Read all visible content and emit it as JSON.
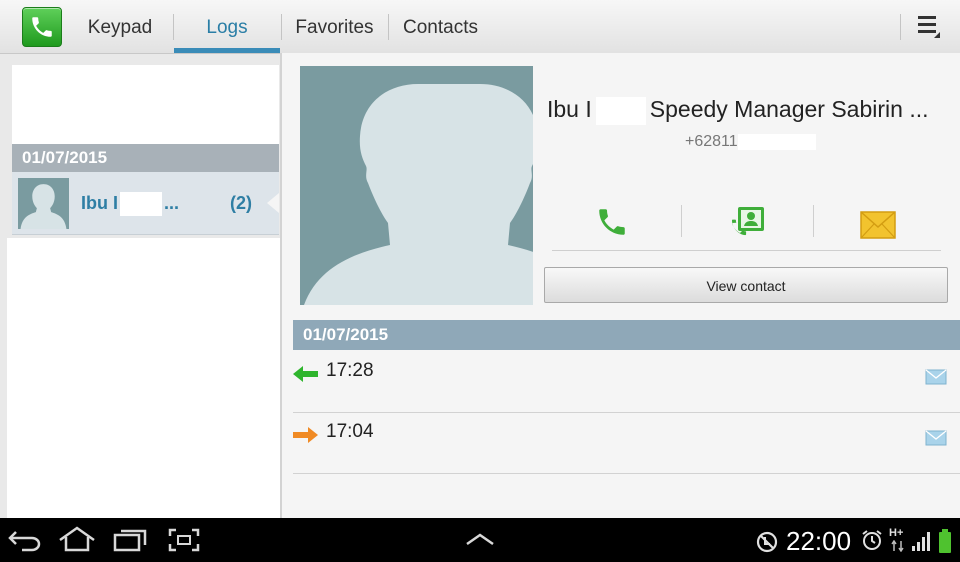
{
  "tabs": [
    {
      "label": "Keypad",
      "active": false
    },
    {
      "label": "Logs",
      "active": true
    },
    {
      "label": "Favorites",
      "active": false
    },
    {
      "label": "Contacts",
      "active": false
    }
  ],
  "left_list": {
    "date_header": "01/07/2015",
    "items": [
      {
        "name": "Ibu I",
        "name_suffix": "...",
        "count": "(2)"
      }
    ]
  },
  "contact": {
    "name_prefix": "Ibu I",
    "name_rest": "Speedy Manager Sabirin ...",
    "number": "+62811"
  },
  "actions": {
    "view_contact_label": "View contact"
  },
  "logs": {
    "date_header": "01/07/2015",
    "entries": [
      {
        "time": "17:28",
        "direction": "incoming",
        "arrow_color": "#2fb52d"
      },
      {
        "time": "17:04",
        "direction": "outgoing",
        "arrow_color": "#f08a24"
      }
    ]
  },
  "status_bar": {
    "clock": "22:00",
    "network": "H+"
  },
  "colors": {
    "accent": "#2e7ea4",
    "tab_underline": "#3a8cb8",
    "date_header_left": "#a8b1b8",
    "date_header_right": "#8fa8b8",
    "avatar_bg": "#7a9ba0"
  }
}
